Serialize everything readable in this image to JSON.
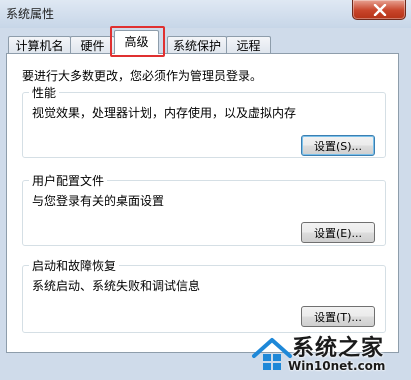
{
  "window": {
    "title": "系统属性",
    "close_icon": "close-icon"
  },
  "tabs": [
    {
      "label": "计算机名",
      "active": false
    },
    {
      "label": "硬件",
      "active": false
    },
    {
      "label": "高级",
      "active": true
    },
    {
      "label": "系统保护",
      "active": false
    },
    {
      "label": "远程",
      "active": false
    }
  ],
  "content": {
    "intro": "要进行大多数更改，您必须作为管理员登录。",
    "performance": {
      "title": "性能",
      "description": "视觉效果，处理器计划，内存使用，以及虚拟内存",
      "button_label": "设置(S)..."
    },
    "user_profiles": {
      "title": "用户配置文件",
      "description": "与您登录有关的桌面设置",
      "button_label": "设置(E)..."
    },
    "startup_recovery": {
      "title": "启动和故障恢复",
      "description": "系统启动、系统失败和调试信息",
      "button_label": "设置(T)..."
    }
  },
  "watermark": {
    "name": "系统之家",
    "site": "Win10net.com",
    "accent_color": "#1e88d8"
  },
  "colors": {
    "highlight_box": "#e03030",
    "close_button": "#c8452a"
  }
}
